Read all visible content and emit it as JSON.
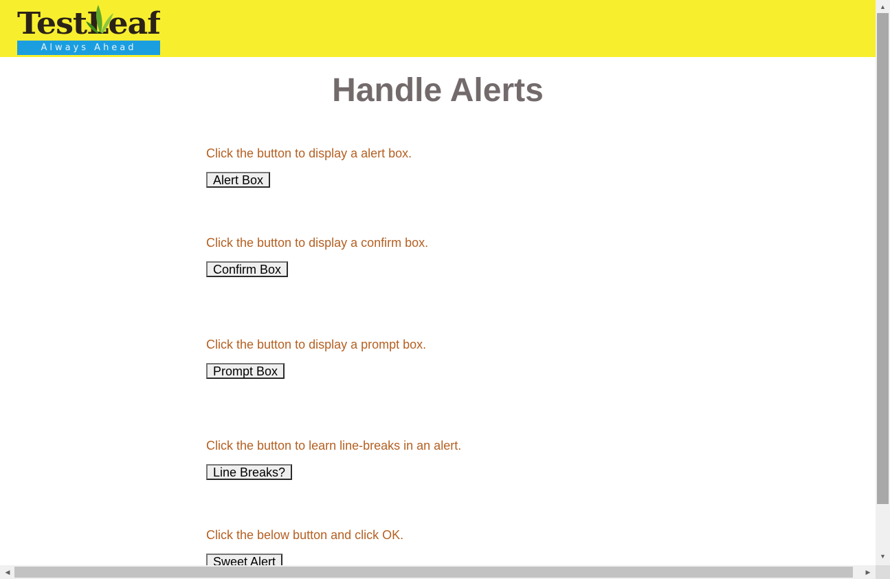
{
  "header": {
    "logo": {
      "wordmark": "TestLeaf",
      "tagline": "Always Ahead",
      "icon": "leaf-icon"
    },
    "colors": {
      "header_bg": "#f7ef2e",
      "tagline_bg": "#1b9ee0"
    }
  },
  "main": {
    "title": "Handle Alerts",
    "sections": [
      {
        "text": "Click the button to display a alert box.",
        "button_label": "Alert Box"
      },
      {
        "text": "Click the button to display a confirm box.",
        "button_label": "Confirm Box"
      },
      {
        "text": "Click the button to display a prompt box.",
        "button_label": "Prompt Box"
      },
      {
        "text": "Click the button to learn line-breaks in an alert.",
        "button_label": "Line Breaks?"
      },
      {
        "text": "Click the below button and click OK.",
        "button_label": "Sweet Alert"
      }
    ],
    "colors": {
      "title": "#736b6b",
      "section_text": "#b45f21"
    }
  },
  "scrollbars": {
    "vertical_icons": [
      "arrow-up-icon",
      "arrow-down-icon"
    ],
    "horizontal_icons": [
      "arrow-left-icon",
      "arrow-right-icon"
    ]
  }
}
